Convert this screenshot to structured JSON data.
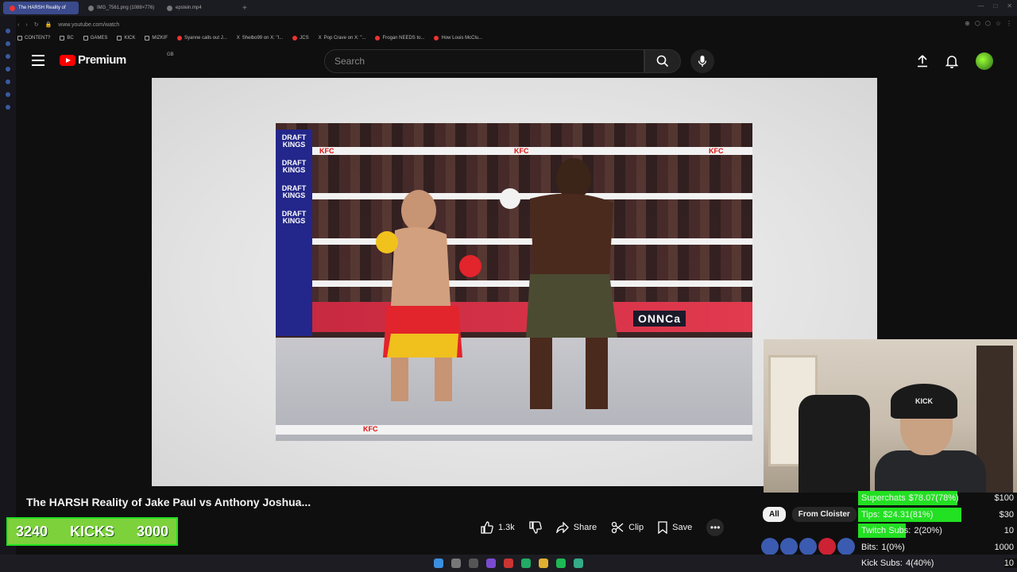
{
  "browser": {
    "tabs": [
      {
        "title": "The HARSH Reality of",
        "active": true
      },
      {
        "title": "IMG_7561.png (1088×776)",
        "active": false
      },
      {
        "title": "epstein.mp4",
        "active": false
      }
    ],
    "url": "www.youtube.com/watch",
    "bookmarks": [
      "CONTENT?",
      "BC",
      "GAMES",
      "KICK",
      "MIZKIF",
      "Syanne calls out J...",
      "Shelbo99 on X: \"I...",
      "JCS",
      "Pop Crave on X: \"...",
      "Frogan NEEDS to...",
      "How Louis McClu..."
    ]
  },
  "youtube": {
    "logo_text": "Premium",
    "region": "GB",
    "search_placeholder": "Search"
  },
  "player": {
    "ring_brands": [
      "KFC",
      "KFC",
      "KFC",
      "KFC"
    ],
    "sponsor_post": [
      "DRAFT KINGS",
      "DRAFT KINGS",
      "DRAFT KINGS",
      "DRAFT KINGS"
    ],
    "banner_text": "ONNCa"
  },
  "video": {
    "title": "The HARSH Reality of Jake Paul vs Anthony Joshua...",
    "likes": "1.3k",
    "share": "Share",
    "clip": "Clip",
    "save": "Save"
  },
  "chips": [
    "All",
    "From Cloister"
  ],
  "webcam": {
    "cap_text": "KICK"
  },
  "overlay": {
    "kicks": {
      "current": "3240",
      "label": "KICKS",
      "goal": "3000"
    },
    "stats": [
      {
        "label": "Superchats",
        "value": "$78.07(78%)",
        "goal": "$100",
        "fill": 0.78
      },
      {
        "label": "Tips:",
        "value": "$24.31(81%)",
        "goal": "$30",
        "fill": 0.81
      },
      {
        "label": "Twitch Subs:",
        "value": "2(20%)",
        "goal": "10",
        "fill": 0.2
      },
      {
        "label": "Bits:",
        "value": "1(0%)",
        "goal": "1000",
        "fill": 0.0
      },
      {
        "label": "Kick Subs:",
        "value": "4(40%)",
        "goal": "10",
        "fill": 0.4
      }
    ]
  },
  "colors": {
    "accent_green": "#22e022",
    "youtube_red": "#ff0000"
  }
}
